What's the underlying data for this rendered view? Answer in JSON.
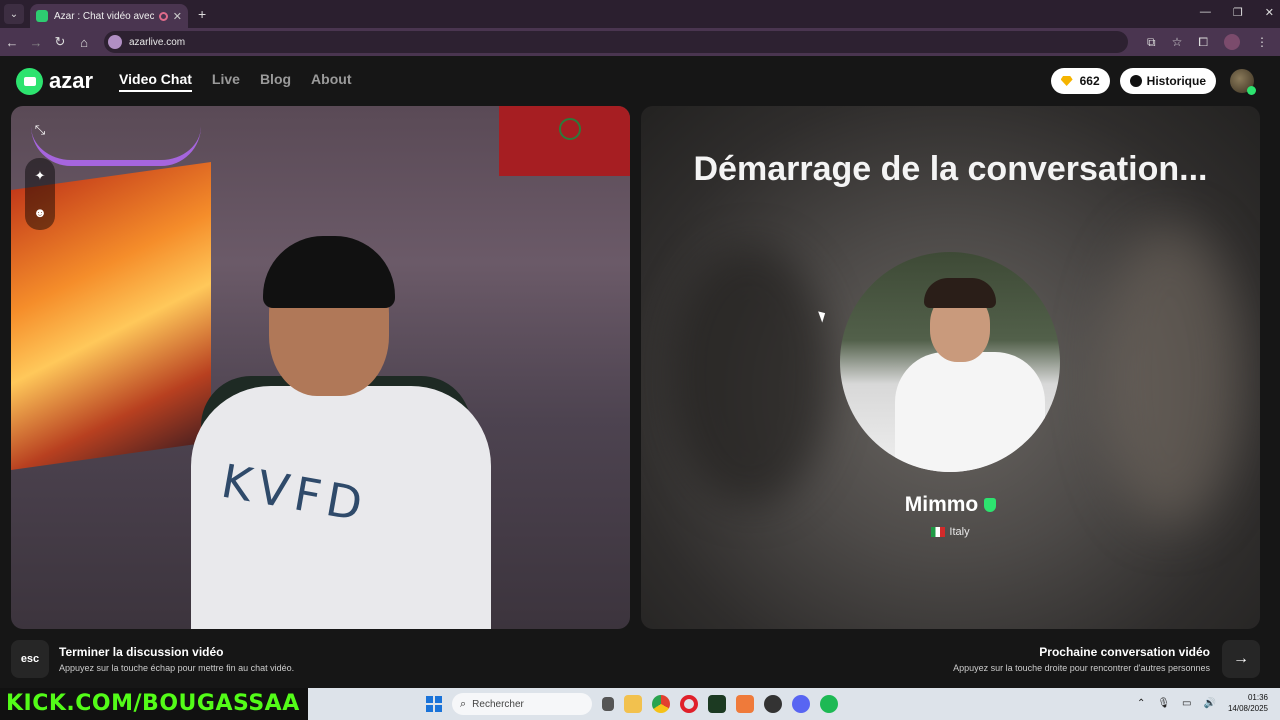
{
  "browser": {
    "tab_title": "Azar : Chat vidéo avec de n",
    "tab_close": "✕",
    "new_tab": "+",
    "url": "azarlive.com",
    "window_controls": [
      "—",
      "❐",
      "✕"
    ]
  },
  "header": {
    "logo_text": "azar",
    "nav": [
      {
        "label": "Video Chat",
        "active": true
      },
      {
        "label": "Live",
        "active": false
      },
      {
        "label": "Blog",
        "active": false
      },
      {
        "label": "About",
        "active": false
      }
    ],
    "gems": "662",
    "history_label": "Historique"
  },
  "left_video": {
    "shirt_text": "KVFD"
  },
  "right_panel": {
    "status": "Démarrage de la conversation...",
    "partner_name": "Mimmo",
    "country": "Italy"
  },
  "footer": {
    "end_key": "esc",
    "end_title": "Terminer la discussion vidéo",
    "end_sub": "Appuyez sur la touche échap pour mettre fin au chat vidéo.",
    "next_title": "Prochaine conversation vidéo",
    "next_sub": "Appuyez sur la touche droite pour rencontrer d'autres personnes",
    "next_arrow": "→"
  },
  "taskbar": {
    "overlay_text": "KICK.COM/BOUGASSAA",
    "search_placeholder": "Rechercher",
    "time": "01:36",
    "date": "14/08/2025"
  },
  "colors": {
    "accent": "#2de36f",
    "gem": "#f5b400",
    "kick": "#53fc18"
  }
}
